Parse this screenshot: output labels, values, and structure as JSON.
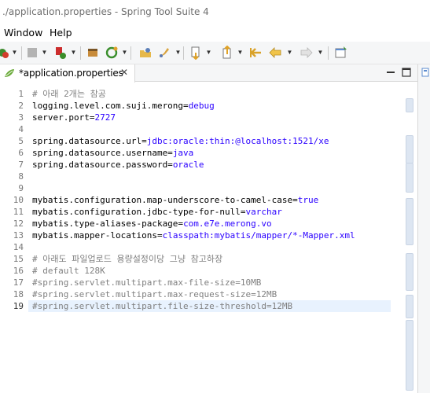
{
  "window": {
    "title": "./application.properties - Spring Tool Suite 4"
  },
  "menubar": {
    "items": [
      "Window",
      "Help"
    ]
  },
  "toolbar": {
    "icons": [
      "debug-run-icon",
      "stop-icon",
      "run-icon",
      "package-icon",
      "new-spring-starter-icon",
      "open-type-icon",
      "open-task-icon",
      "annotation-icon",
      "next-annotation-icon",
      "prev-annotation-icon",
      "back-icon",
      "forward-icon",
      "pin-editor-icon"
    ]
  },
  "editor": {
    "tab_label": "*application.properties",
    "tab_close": "✕",
    "lines": [
      {
        "n": "1",
        "parts": [
          {
            "t": "# 아래 2개는 참공",
            "c": "c"
          }
        ]
      },
      {
        "n": "2",
        "parts": [
          {
            "t": "logging.level.com.suji.merong=",
            "c": "k"
          },
          {
            "t": "debug",
            "c": "v"
          }
        ]
      },
      {
        "n": "3",
        "parts": [
          {
            "t": "server.port=",
            "c": "k"
          },
          {
            "t": "2727",
            "c": "v"
          }
        ]
      },
      {
        "n": "4",
        "parts": []
      },
      {
        "n": "5",
        "parts": [
          {
            "t": "spring.datasource.url=",
            "c": "k"
          },
          {
            "t": "jdbc:oracle:thin:@localhost:1521/xe",
            "c": "v"
          }
        ]
      },
      {
        "n": "6",
        "parts": [
          {
            "t": "spring.datasource.username=",
            "c": "k"
          },
          {
            "t": "java",
            "c": "v"
          }
        ]
      },
      {
        "n": "7",
        "parts": [
          {
            "t": "spring.datasource.password=",
            "c": "k"
          },
          {
            "t": "oracle",
            "c": "v"
          }
        ]
      },
      {
        "n": "8",
        "parts": []
      },
      {
        "n": "9",
        "parts": []
      },
      {
        "n": "10",
        "parts": [
          {
            "t": "mybatis.configuration.map-underscore-to-camel-case=",
            "c": "k"
          },
          {
            "t": "true",
            "c": "v"
          }
        ]
      },
      {
        "n": "11",
        "parts": [
          {
            "t": "mybatis.configuration.jdbc-type-for-null=",
            "c": "k"
          },
          {
            "t": "varchar",
            "c": "v"
          }
        ]
      },
      {
        "n": "12",
        "parts": [
          {
            "t": "mybatis.type-aliases-package=",
            "c": "k"
          },
          {
            "t": "com.e7e.merong.vo",
            "c": "v"
          }
        ]
      },
      {
        "n": "13",
        "parts": [
          {
            "t": "mybatis.mapper-locations=",
            "c": "k"
          },
          {
            "t": "classpath:mybatis/mapper/*-Mapper.xml",
            "c": "v"
          }
        ]
      },
      {
        "n": "14",
        "parts": []
      },
      {
        "n": "15",
        "parts": [
          {
            "t": "# 아래도 파일업로드 용량설정이당 그냥 참고하장",
            "c": "c"
          }
        ]
      },
      {
        "n": "16",
        "parts": [
          {
            "t": "# default 128K",
            "c": "c"
          }
        ]
      },
      {
        "n": "17",
        "parts": [
          {
            "t": "#spring.servlet.multipart.max-file-size=10MB",
            "c": "c"
          }
        ]
      },
      {
        "n": "18",
        "parts": [
          {
            "t": "#spring.servlet.multipart.max-request-size=12MB",
            "c": "c"
          }
        ]
      },
      {
        "n": "19",
        "parts": [
          {
            "t": "#spring.servlet.multipart.file-size-threshold=12MB",
            "c": "c"
          }
        ]
      }
    ],
    "current_line": "19"
  }
}
